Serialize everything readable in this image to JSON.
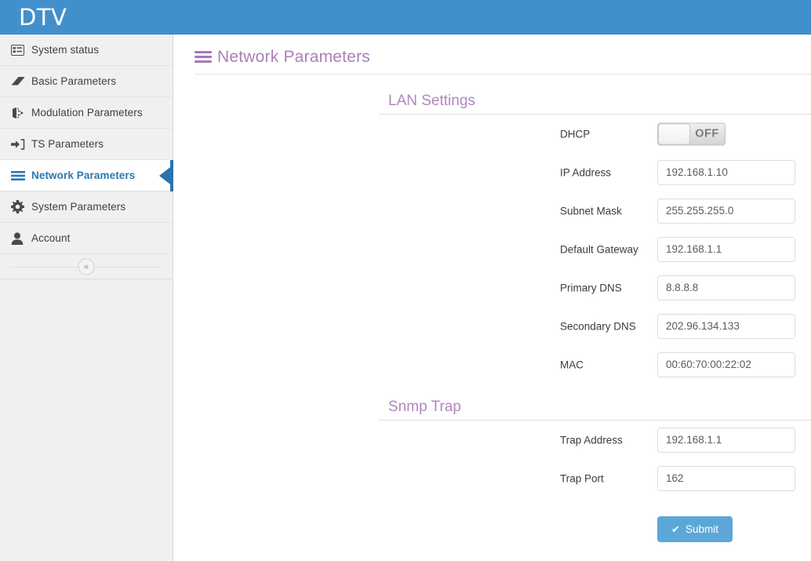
{
  "header": {
    "brand": "DTV",
    "brand_color": "#4290cb"
  },
  "sidebar": {
    "collapse_label": "«",
    "items": [
      {
        "label": "System status",
        "icon": "list-alt-icon",
        "active": false
      },
      {
        "label": "Basic Parameters",
        "icon": "eraser-icon",
        "active": false
      },
      {
        "label": "Modulation Parameters",
        "icon": "sign-out-icon",
        "active": false
      },
      {
        "label": "TS Parameters",
        "icon": "sign-in-icon",
        "active": false
      },
      {
        "label": "Network Parameters",
        "icon": "bars-icon",
        "active": true
      },
      {
        "label": "System Parameters",
        "icon": "gear-icon",
        "active": false
      },
      {
        "label": "Account",
        "icon": "user-icon",
        "active": false
      }
    ],
    "active_color": "#2a7ab0"
  },
  "page": {
    "title": "Network Parameters",
    "title_icon": "bars-icon",
    "title_color": "#a981b8"
  },
  "sections": [
    {
      "title": "LAN Settings",
      "rows": [
        {
          "label": "DHCP",
          "type": "toggle",
          "state": "OFF"
        },
        {
          "label": "IP Address",
          "type": "text",
          "value": "192.168.1.10"
        },
        {
          "label": "Subnet Mask",
          "type": "text",
          "value": "255.255.255.0"
        },
        {
          "label": "Default Gateway",
          "type": "text",
          "value": "192.168.1.1"
        },
        {
          "label": "Primary DNS",
          "type": "text",
          "value": "8.8.8.8"
        },
        {
          "label": "Secondary DNS",
          "type": "text",
          "value": "202.96.134.133"
        },
        {
          "label": "MAC",
          "type": "text",
          "value": "00:60:70:00:22:02"
        }
      ]
    },
    {
      "title": "Snmp Trap",
      "rows": [
        {
          "label": "Trap Address",
          "type": "text",
          "value": "192.168.1.1"
        },
        {
          "label": "Trap Port",
          "type": "text",
          "value": "162"
        }
      ]
    }
  ],
  "submit": {
    "label": "Submit",
    "icon": "check-icon",
    "color": "#5ba7d8"
  }
}
